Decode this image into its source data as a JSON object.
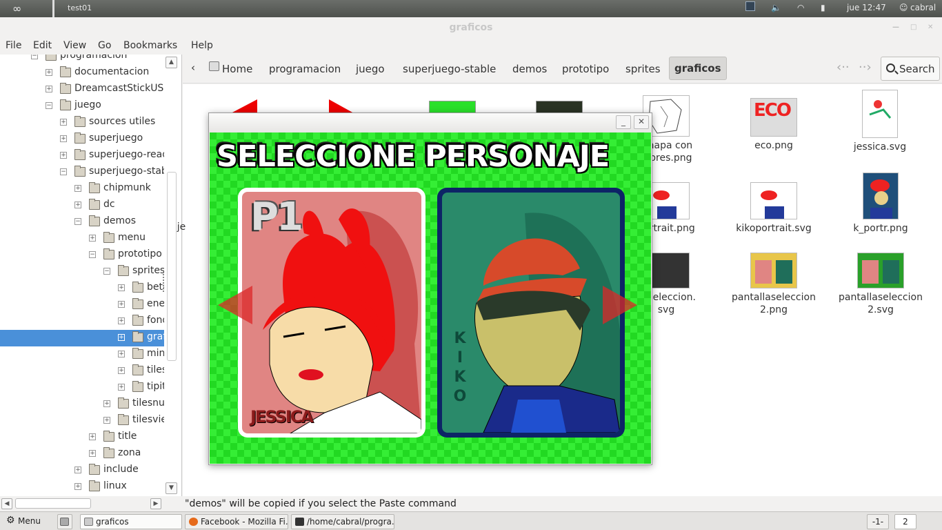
{
  "topbar": {
    "workspace": "test01",
    "clock": "jue 12:47",
    "user": "cabral"
  },
  "window": {
    "title": "graficos"
  },
  "menu": [
    "File",
    "Edit",
    "View",
    "Go",
    "Bookmarks",
    "Help"
  ],
  "sidebar": {
    "items": [
      {
        "label": "programacion",
        "depth": 1,
        "expanded": true
      },
      {
        "label": "documentacion",
        "depth": 2,
        "expanded": false
      },
      {
        "label": "DreamcastStickUSB",
        "depth": 2,
        "expanded": false
      },
      {
        "label": "juego",
        "depth": 2,
        "expanded": true
      },
      {
        "label": "sources utiles",
        "depth": 3,
        "expanded": false
      },
      {
        "label": "superjuego",
        "depth": 3,
        "expanded": false
      },
      {
        "label": "superjuego-read-o",
        "depth": 3,
        "expanded": false
      },
      {
        "label": "superjuego-stable",
        "depth": 3,
        "expanded": true
      },
      {
        "label": "chipmunk",
        "depth": 4,
        "expanded": false
      },
      {
        "label": "dc",
        "depth": 4,
        "expanded": false
      },
      {
        "label": "demos",
        "depth": 4,
        "expanded": true
      },
      {
        "label": "menu",
        "depth": 5,
        "expanded": false
      },
      {
        "label": "prototipo",
        "depth": 5,
        "expanded": true
      },
      {
        "label": "sprites",
        "depth": 6,
        "expanded": true
      },
      {
        "label": "beta",
        "depth": 7,
        "expanded": false
      },
      {
        "label": "enemig",
        "depth": 7,
        "expanded": false
      },
      {
        "label": "fondos",
        "depth": 7,
        "expanded": false
      },
      {
        "label": "grafico",
        "depth": 7,
        "expanded": false,
        "selected": true
      },
      {
        "label": "minita",
        "depth": 7,
        "expanded": false
      },
      {
        "label": "tiles",
        "depth": 7,
        "expanded": false
      },
      {
        "label": "tipito",
        "depth": 7,
        "expanded": false
      },
      {
        "label": "tilesnuev",
        "depth": 6,
        "expanded": false
      },
      {
        "label": "tilesviejo",
        "depth": 6,
        "expanded": false
      },
      {
        "label": "title",
        "depth": 5,
        "expanded": false
      },
      {
        "label": "zona",
        "depth": 5,
        "expanded": false
      },
      {
        "label": "include",
        "depth": 4,
        "expanded": false
      },
      {
        "label": "linux",
        "depth": 4,
        "expanded": false
      }
    ]
  },
  "pathbar": {
    "crumbs": [
      "Home",
      "programacion",
      "juego",
      "superjuego-stable",
      "demos",
      "prototipo",
      "sprites",
      "graficos"
    ],
    "search_label": "Search"
  },
  "files": [
    {
      "name": "_mapa con",
      "name2": "mbres.png"
    },
    {
      "name": "eco.png",
      "name2": ""
    },
    {
      "name": "jessica.svg",
      "name2": ""
    },
    {
      "name": "portrait.png",
      "name2": ""
    },
    {
      "name": "kikoportrait.svg",
      "name2": ""
    },
    {
      "name": "k_portr.png",
      "name2": ""
    },
    {
      "name": "llaseleccion.",
      "name2": "svg"
    },
    {
      "name": "pantallaseleccion",
      "name2": "2.png"
    },
    {
      "name": "pantallaseleccion",
      "name2": "2.svg"
    },
    {
      "name": "je",
      "name2": ""
    }
  ],
  "eco_thumb_text": "ECO",
  "status": "\"demos\" will be copied if you select the Paste command",
  "dialog": {
    "game_title": "SELECCIONE PERSONAJE",
    "p1_label": "P1",
    "left_name": "JESSICA",
    "right_name_letters": [
      "K",
      "I",
      "K",
      "O"
    ]
  },
  "taskbar": {
    "menu_label": "Menu",
    "tasks": [
      "graficos",
      "Facebook - Mozilla Fi...",
      "/home/cabral/progra..."
    ],
    "pager": [
      "-1-",
      "2"
    ]
  },
  "colors": {
    "selection": "#4a90d9",
    "game_green": "#22d922",
    "card_pink": "#e08583",
    "card_teal": "#1f6e5a"
  }
}
